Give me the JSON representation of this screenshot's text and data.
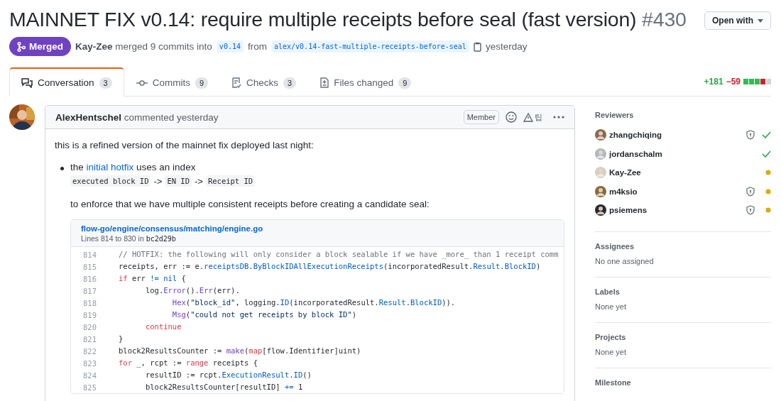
{
  "title": {
    "text": "MAINNET FIX v0.14: require multiple receipts before seal (fast version)",
    "number": "#430"
  },
  "open_with": "Open with",
  "meta": {
    "state": "Merged",
    "author": "Kay-Zee",
    "action": "merged 9 commits into",
    "base": "v0.14",
    "from": "from",
    "head": "alex/v0.14-fast-multiple-receipts-before-seal",
    "time": "yesterday"
  },
  "tabs": [
    {
      "label": "Conversation",
      "count": "3",
      "selected": true
    },
    {
      "label": "Commits",
      "count": "9",
      "selected": false
    },
    {
      "label": "Checks",
      "count": "3",
      "selected": false
    },
    {
      "label": "Files changed",
      "count": "9",
      "selected": false
    }
  ],
  "diffstat": {
    "additions": "+181",
    "deletions": "−59",
    "blocks": [
      {
        "color": "#2cbe4e"
      },
      {
        "color": "#2cbe4e"
      },
      {
        "color": "#2cbe4e"
      },
      {
        "color": "#cb2431"
      },
      {
        "color": "#d1d5da"
      }
    ]
  },
  "comment": {
    "author": "AlexHentschel",
    "action": "commented yesterday",
    "badge": "Member",
    "tip": "팁",
    "intro": "this is a refined version of the mainnet fix deployed last night:",
    "bullet": {
      "before": "the",
      "link": "initial hotfix",
      "after": "uses an index",
      "index": [
        "executed block ID",
        "EN ID",
        "Receipt ID"
      ],
      "separator": "->"
    },
    "follow": "to enforce that we have multiple consistent receipts before creating a candidate seal:",
    "snippet": {
      "path": "flow-go/engine/consensus/matching/engine.go",
      "range": "Lines 814 to 830 in",
      "commit": "bc2d29b",
      "lines": [
        {
          "number": "814",
          "tokens": [
            {
              "kind": "comment",
              "text": "// HOTFIX: the following will only consider a block sealable if we have _more_ than 1 receipt comm"
            }
          ]
        },
        {
          "number": "815",
          "tokens": [
            {
              "kind": "plain",
              "text": "receipts, err := e."
            },
            {
              "kind": "field",
              "text": "receiptsDB"
            },
            {
              "kind": "plain",
              "text": "."
            },
            {
              "kind": "field",
              "text": "ByBlockIDAllExecutionReceipts"
            },
            {
              "kind": "plain",
              "text": "(incorporatedResult."
            },
            {
              "kind": "field",
              "text": "Result"
            },
            {
              "kind": "plain",
              "text": "."
            },
            {
              "kind": "field",
              "text": "BlockID"
            },
            {
              "kind": "plain",
              "text": ")"
            }
          ]
        },
        {
          "number": "816",
          "tokens": [
            {
              "kind": "keyword",
              "text": "if"
            },
            {
              "kind": "plain",
              "text": " err "
            },
            {
              "kind": "field",
              "text": "!= nil"
            },
            {
              "kind": "plain",
              "text": " {"
            }
          ]
        },
        {
          "number": "817",
          "tokens": [
            {
              "kind": "plain",
              "text": "\tlog."
            },
            {
              "kind": "func",
              "text": "Error"
            },
            {
              "kind": "plain",
              "text": "()."
            },
            {
              "kind": "func",
              "text": "Err"
            },
            {
              "kind": "plain",
              "text": "(err)."
            }
          ]
        },
        {
          "number": "818",
          "tokens": [
            {
              "kind": "func",
              "text": "\t\tHex"
            },
            {
              "kind": "plain",
              "text": "("
            },
            {
              "kind": "string",
              "text": "\"block_id\""
            },
            {
              "kind": "plain",
              "text": ", logging."
            },
            {
              "kind": "field",
              "text": "ID"
            },
            {
              "kind": "plain",
              "text": "(incorporatedResult."
            },
            {
              "kind": "field",
              "text": "Result"
            },
            {
              "kind": "plain",
              "text": "."
            },
            {
              "kind": "field",
              "text": "BlockID"
            },
            {
              "kind": "plain",
              "text": "))."
            }
          ]
        },
        {
          "number": "819",
          "tokens": [
            {
              "kind": "func",
              "text": "\t\tMsg"
            },
            {
              "kind": "plain",
              "text": "("
            },
            {
              "kind": "string",
              "text": "\"could not get receipts by block ID\""
            },
            {
              "kind": "plain",
              "text": ")"
            }
          ]
        },
        {
          "number": "820",
          "tokens": [
            {
              "kind": "keyword",
              "text": "\tcontinue"
            }
          ]
        },
        {
          "number": "821",
          "tokens": [
            {
              "kind": "plain",
              "text": "}"
            }
          ]
        },
        {
          "number": "822",
          "tokens": [
            {
              "kind": "plain",
              "text": "block2ResultsCounter := "
            },
            {
              "kind": "func",
              "text": "make"
            },
            {
              "kind": "plain",
              "text": "("
            },
            {
              "kind": "keyword",
              "text": "map"
            },
            {
              "kind": "plain",
              "text": "[flow.Identifier]uint)"
            }
          ]
        },
        {
          "number": "823",
          "tokens": [
            {
              "kind": "keyword",
              "text": "for"
            },
            {
              "kind": "plain",
              "text": " _, rcpt := "
            },
            {
              "kind": "keyword",
              "text": "range"
            },
            {
              "kind": "plain",
              "text": " receipts {"
            }
          ]
        },
        {
          "number": "824",
          "tokens": [
            {
              "kind": "plain",
              "text": "\tresultID := rcpt."
            },
            {
              "kind": "field",
              "text": "ExecutionResult"
            },
            {
              "kind": "plain",
              "text": "."
            },
            {
              "kind": "field",
              "text": "ID"
            },
            {
              "kind": "plain",
              "text": "()"
            }
          ]
        },
        {
          "number": "825",
          "tokens": [
            {
              "kind": "plain",
              "text": "\tblock2ResultsCounter[resultID] "
            },
            {
              "kind": "field",
              "text": "+="
            },
            {
              "kind": "plain",
              "text": " 1"
            }
          ]
        }
      ]
    }
  },
  "sidebar": {
    "reviewers_title": "Reviewers",
    "reviewers": [
      {
        "name": "zhangchiqing",
        "code_owner": true,
        "approved": true,
        "color": "#8a6a4a"
      },
      {
        "name": "jordanschalm",
        "code_owner": false,
        "approved": true,
        "color": "#b0b8c0"
      },
      {
        "name": "Kay-Zee",
        "code_owner": false,
        "approved": false,
        "color": "#d8cfc0"
      },
      {
        "name": "m4ksio",
        "code_owner": true,
        "approved": false,
        "color": "#8a6a3a"
      },
      {
        "name": "psiemens",
        "code_owner": true,
        "approved": false,
        "color": "#2a2a2a"
      }
    ],
    "sections": [
      {
        "title": "Assignees",
        "value": "No one assigned"
      },
      {
        "title": "Labels",
        "value": "None yet"
      },
      {
        "title": "Projects",
        "value": "None yet"
      },
      {
        "title": "Milestone"
      }
    ]
  }
}
